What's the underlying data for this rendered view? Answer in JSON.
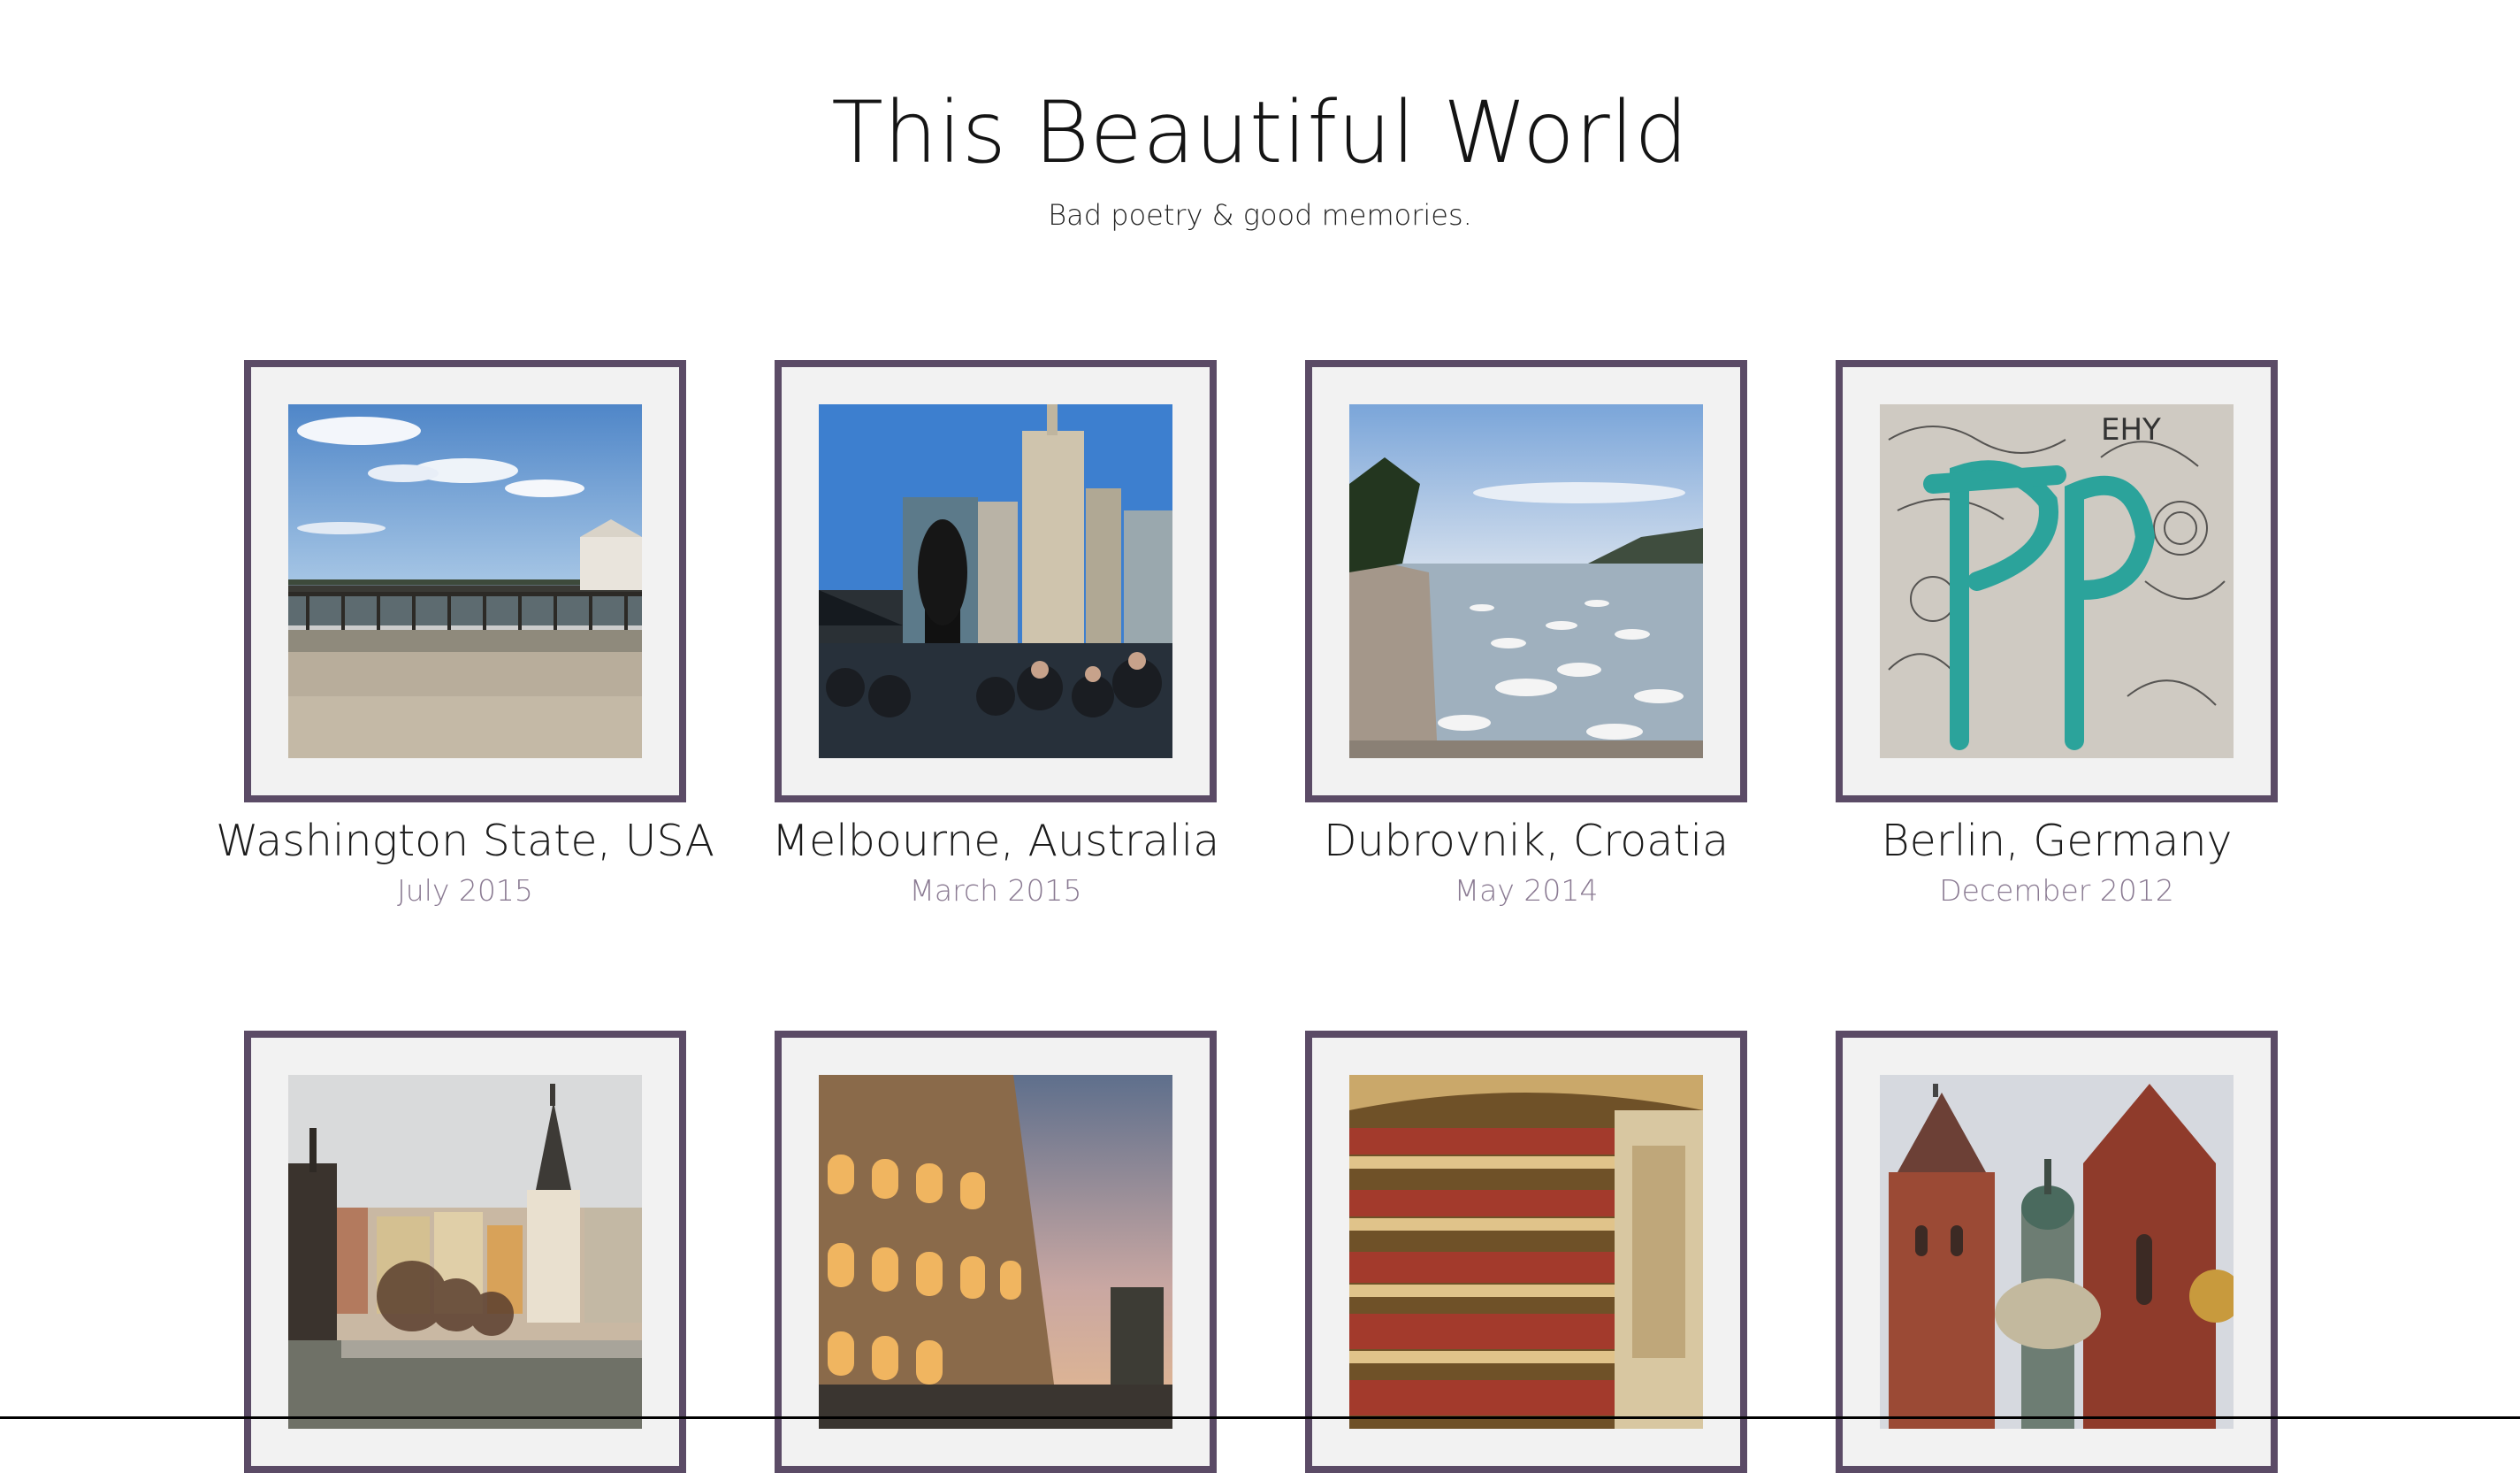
{
  "site": {
    "title": "This Beautiful World",
    "subtitle": "Bad poetry & good memories."
  },
  "colors": {
    "frame_border": "#5b4b66",
    "frame_fill": "#f2f2f2",
    "date_text": "#8a7a92"
  },
  "gallery": [
    {
      "place": "Washington State, USA",
      "date": "July 2015",
      "photo": "beach-pier-photo"
    },
    {
      "place": "Melbourne, Australia",
      "date": "March 2015",
      "photo": "city-skyline-photo"
    },
    {
      "place": "Dubrovnik, Croatia",
      "date": "May 2014",
      "photo": "harbor-boats-photo"
    },
    {
      "place": "Berlin, Germany",
      "date": "December 2012",
      "photo": "graffiti-wall-photo"
    },
    {
      "place": "",
      "date": "",
      "photo": "riverside-town-photo"
    },
    {
      "place": "",
      "date": "",
      "photo": "colosseum-photo"
    },
    {
      "place": "",
      "date": "",
      "photo": "opera-house-interior-photo"
    },
    {
      "place": "",
      "date": "",
      "photo": "cathedral-towers-photo"
    }
  ]
}
